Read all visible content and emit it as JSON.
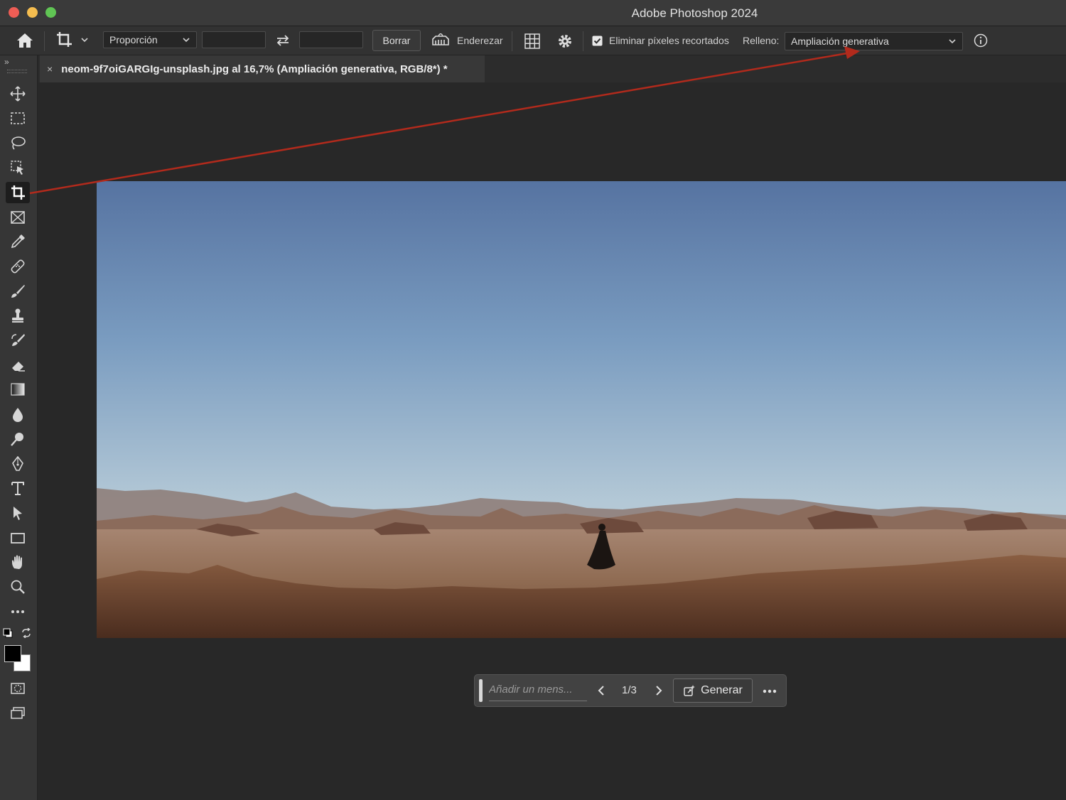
{
  "app": {
    "title": "Adobe Photoshop 2024"
  },
  "options_bar": {
    "ratio_preset": "Proporción",
    "width_value": "",
    "height_value": "",
    "clear_label": "Borrar",
    "straighten_label": "Enderezar",
    "delete_cropped_checked": true,
    "delete_cropped_label": "Eliminar píxeles recortados",
    "fill_label": "Relleno:",
    "fill_value": "Ampliación generativa"
  },
  "document": {
    "tab_title": "neom-9f7oiGARGIg-unsplash.jpg al 16,7% (Ampliación generativa, RGB/8*) *"
  },
  "contextual_bar": {
    "prompt_placeholder": "Añadir un mens...",
    "variation_counter": "1/3",
    "generate_label": "Generar"
  },
  "tools": [
    {
      "name": "move-tool"
    },
    {
      "name": "marquee-tool"
    },
    {
      "name": "lasso-tool"
    },
    {
      "name": "object-selection-tool"
    },
    {
      "name": "crop-tool",
      "active": true
    },
    {
      "name": "frame-tool"
    },
    {
      "name": "eyedropper-tool"
    },
    {
      "name": "healing-brush-tool"
    },
    {
      "name": "brush-tool"
    },
    {
      "name": "clone-stamp-tool"
    },
    {
      "name": "history-brush-tool"
    },
    {
      "name": "eraser-tool"
    },
    {
      "name": "gradient-tool"
    },
    {
      "name": "blur-tool"
    },
    {
      "name": "dodge-tool"
    },
    {
      "name": "pen-tool"
    },
    {
      "name": "type-tool"
    },
    {
      "name": "path-selection-tool"
    },
    {
      "name": "rectangle-tool"
    },
    {
      "name": "hand-tool"
    },
    {
      "name": "zoom-tool"
    },
    {
      "name": "more-tools"
    }
  ],
  "colors": {
    "foreground": "#000000",
    "background": "#ffffff",
    "annotation_arrow": "#b22a1c"
  }
}
